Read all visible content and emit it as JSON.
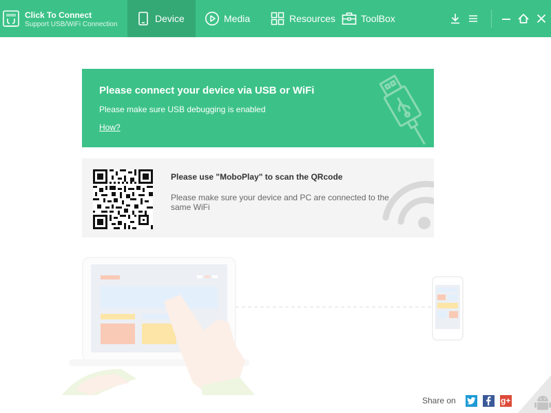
{
  "brand": {
    "title": "Click To Connect",
    "subtitle": "Support USB/WiFi Connection",
    "icon": "connect-logo-icon"
  },
  "nav": [
    {
      "label": "Device",
      "icon": "tablet-icon",
      "active": true
    },
    {
      "label": "Media",
      "icon": "play-circle-icon",
      "active": false
    },
    {
      "label": "Resources",
      "icon": "grid-icon",
      "active": false
    },
    {
      "label": "ToolBox",
      "icon": "toolbox-icon",
      "active": false
    }
  ],
  "window_controls": [
    "download-icon",
    "menu-icon",
    "minimize-icon",
    "home-icon",
    "close-icon"
  ],
  "usb": {
    "title": "Please connect your device via USB or WiFi",
    "subtitle": "Please make sure USB debugging is enabled",
    "link": "How?"
  },
  "wifi": {
    "title": "Please use \"MoboPlay\" to scan the QRcode",
    "description": "Please make sure your device and PC are connected to the same WiFi"
  },
  "share": {
    "label": "Share on",
    "networks": [
      {
        "name": "twitter",
        "color": "#1d9bd6"
      },
      {
        "name": "facebook",
        "color": "#3b5998"
      },
      {
        "name": "google-plus",
        "color": "#dc4a38",
        "glyph": "g+"
      }
    ]
  },
  "colors": {
    "accent": "#3cc288",
    "accent_dark": "#34a975",
    "card_bg": "#f4f4f4"
  }
}
